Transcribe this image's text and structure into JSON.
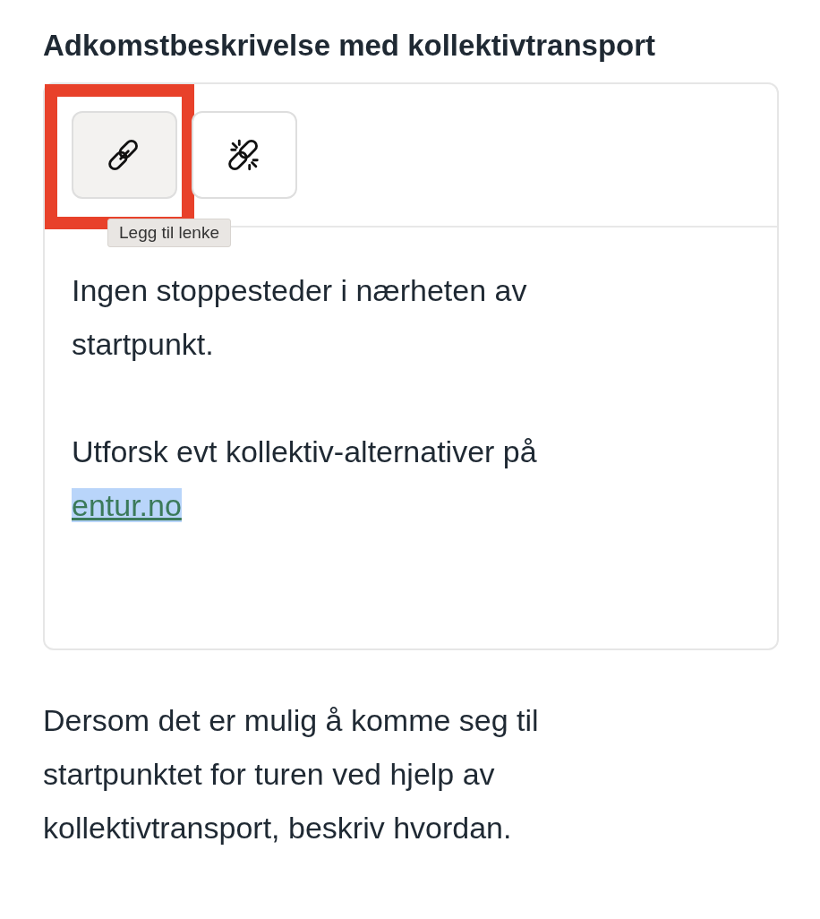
{
  "heading": "Adkomstbeskrivelse med kollektivtransport",
  "editor": {
    "toolbar": [
      {
        "kind": "link",
        "selected": true,
        "highlighted": true,
        "tooltip": "Legg til lenke"
      },
      {
        "kind": "unlink",
        "selected": false,
        "highlighted": false
      }
    ],
    "paragraphs": [
      {
        "text": "Ingen stoppesteder i nærheten av startpunkt."
      },
      {
        "text": "Utforsk evt kollektiv-alternativer på",
        "link": {
          "text": "entur.no",
          "selected": true
        }
      }
    ]
  },
  "help_text": "Dersom det er mulig å komme seg til startpunktet for turen ved hjelp av kollektivtransport, beskriv hvordan."
}
